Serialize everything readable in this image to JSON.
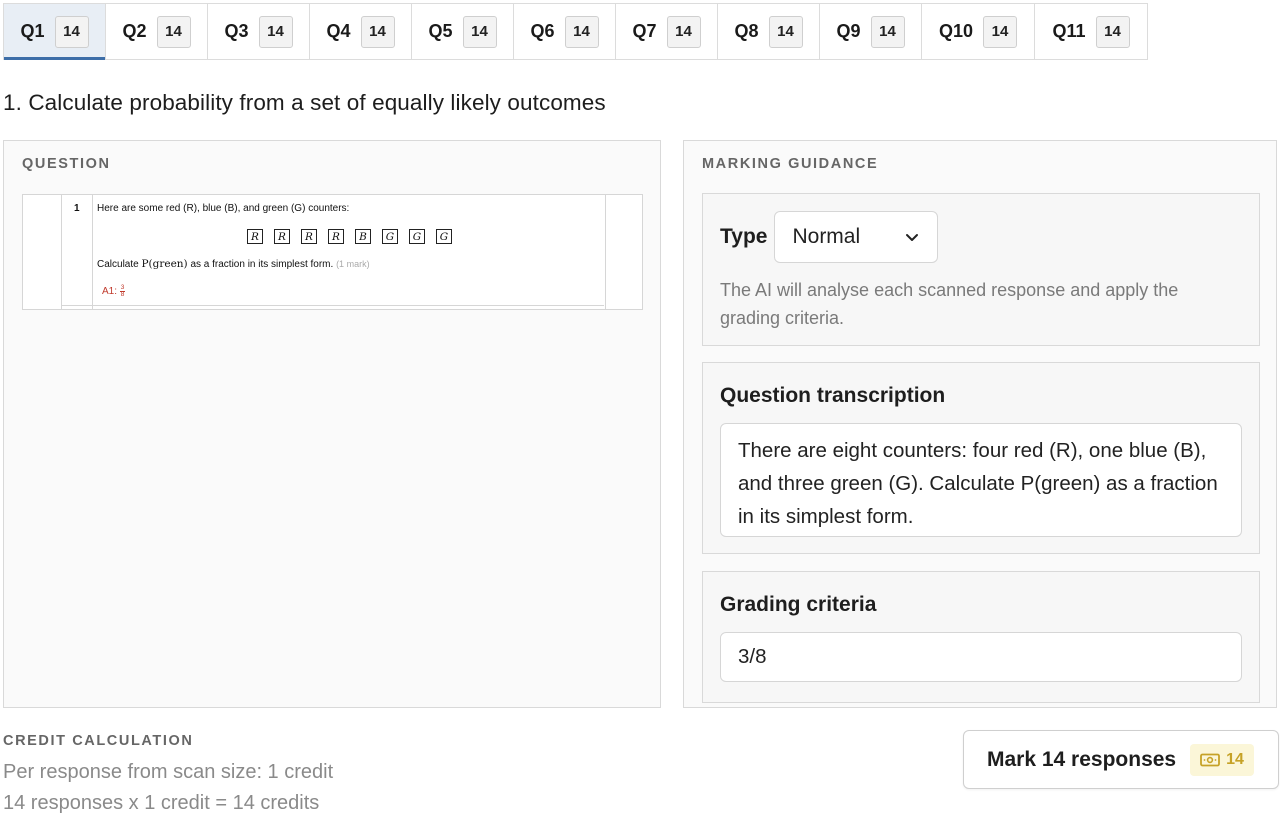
{
  "tabs": [
    {
      "label": "Q1",
      "count": "14",
      "active": true
    },
    {
      "label": "Q2",
      "count": "14"
    },
    {
      "label": "Q3",
      "count": "14"
    },
    {
      "label": "Q4",
      "count": "14"
    },
    {
      "label": "Q5",
      "count": "14"
    },
    {
      "label": "Q6",
      "count": "14"
    },
    {
      "label": "Q7",
      "count": "14"
    },
    {
      "label": "Q8",
      "count": "14"
    },
    {
      "label": "Q9",
      "count": "14"
    },
    {
      "label": "Q10",
      "count": "14"
    },
    {
      "label": "Q11",
      "count": "14"
    }
  ],
  "title": "1. Calculate probability from a set of equally likely outcomes",
  "question": {
    "heading": "QUESTION",
    "number": "1",
    "line1": "Here are some red (R), blue (B), and green (G) counters:",
    "counters": [
      "R",
      "R",
      "R",
      "R",
      "B",
      "G",
      "G",
      "G"
    ],
    "line2_prefix": "Calculate ",
    "line2_math": "P(green)",
    "line2_suffix": " as a fraction in its simplest form.",
    "marks": "(1 mark)",
    "answer_label": "A1:",
    "answer_numerator": "3",
    "answer_denominator": "8"
  },
  "guidance": {
    "heading": "MARKING GUIDANCE",
    "type_label": "Type",
    "type_value": "Normal",
    "type_help": "The AI will analyse each scanned response and apply the grading criteria.",
    "transcription_title": "Question transcription",
    "transcription_text": "There are eight counters: four red (R), one blue (B), and three green (G). Calculate P(green) as a fraction in its simplest form.",
    "criteria_title": "Grading criteria",
    "criteria_text": "3/8"
  },
  "credit": {
    "heading": "CREDIT CALCULATION",
    "line1": "Per response from scan size: 1 credit",
    "line2": "14 responses x 1 credit = 14 credits"
  },
  "mark_button": {
    "label": "Mark 14 responses",
    "credits": "14",
    "icon": "money-icon"
  },
  "colors": {
    "accent": "#3d6ea8",
    "credit_badge_bg": "#fbf6d8",
    "credit_badge_text": "#c6a227",
    "answer_red": "#c0392b"
  }
}
